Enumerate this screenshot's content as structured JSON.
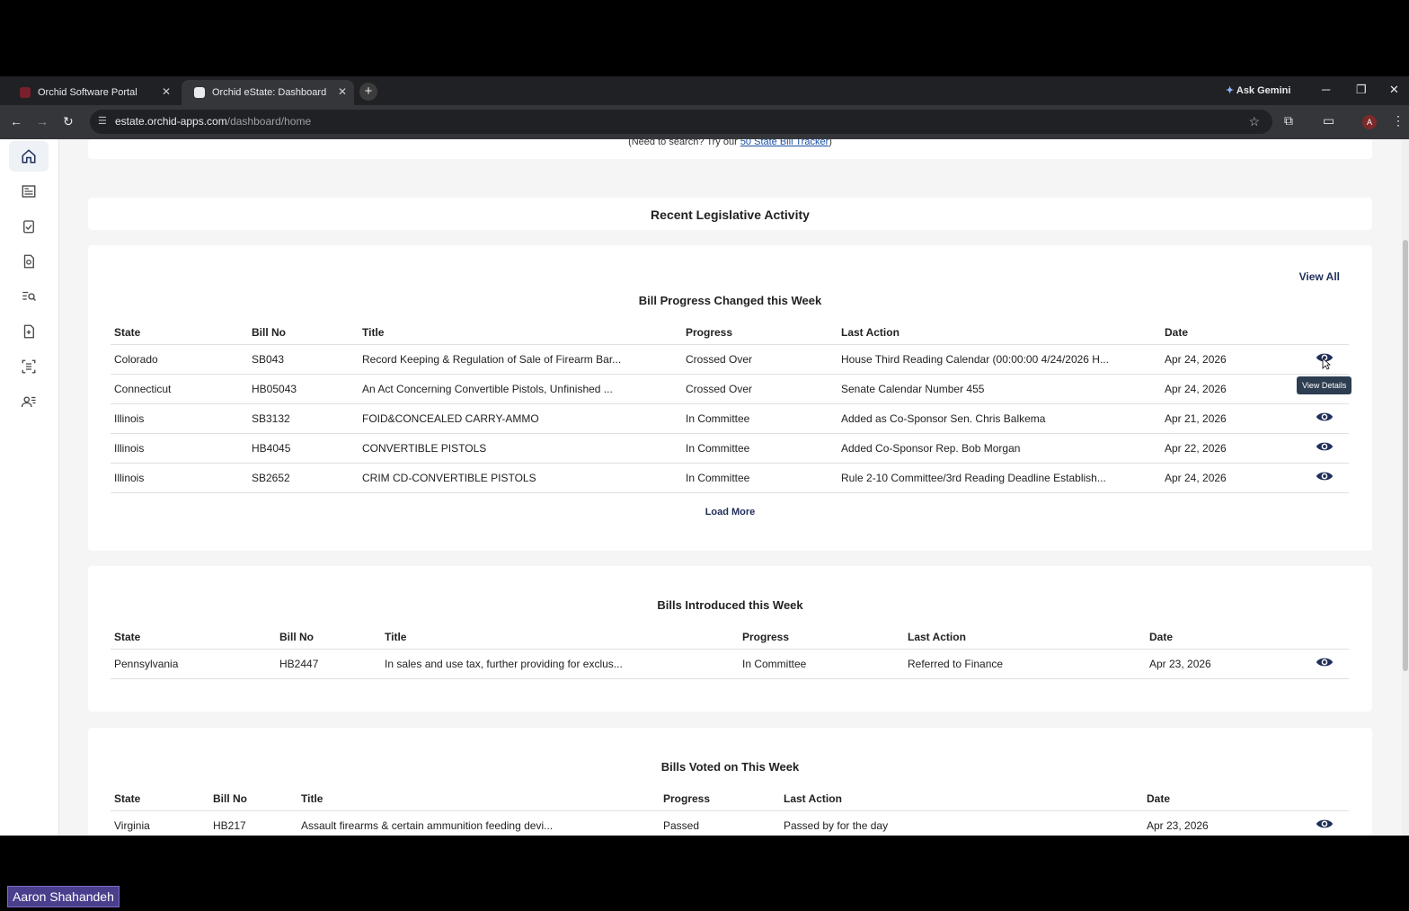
{
  "browser": {
    "tabs": [
      {
        "label": "Orchid Software Portal",
        "active": false
      },
      {
        "label": "Orchid eState: Dashboard",
        "active": true
      }
    ],
    "new_tab": "+",
    "ask_gemini": "Ask Gemini",
    "url_host": "estate.orchid-apps.com",
    "url_path": "/dashboard/home",
    "profile_initial": "A"
  },
  "sidebar": {
    "items": [
      {
        "icon": "home-icon",
        "active": true
      },
      {
        "icon": "newspaper-icon"
      },
      {
        "icon": "clipboard-check-icon"
      },
      {
        "icon": "document-search-icon"
      },
      {
        "icon": "list-search-icon"
      },
      {
        "icon": "file-add-icon"
      },
      {
        "icon": "scan-document-icon"
      },
      {
        "icon": "users-icon"
      }
    ]
  },
  "search_note": {
    "prefix": "(Need to search? Try our ",
    "link": "50 State Bill Tracker",
    "suffix": ")"
  },
  "recent_activity_title": "Recent Legislative Activity",
  "progress_section": {
    "view_all": "View All",
    "title": "Bill Progress Changed this Week",
    "headers": [
      "State",
      "Bill No",
      "Title",
      "Progress",
      "Last Action",
      "Date"
    ],
    "rows": [
      [
        "Colorado",
        "SB043",
        "Record Keeping & Regulation of Sale of Firearm Bar...",
        "Crossed Over",
        "House Third Reading Calendar (00:00:00 4/24/2026 H...",
        "Apr 24, 2026"
      ],
      [
        "Connecticut",
        "HB05043",
        "An Act Concerning Convertible Pistols, Unfinished ...",
        "Crossed Over",
        "Senate Calendar Number 455",
        "Apr 24, 2026"
      ],
      [
        "Illinois",
        "SB3132",
        "FOID&CONCEALED CARRY-AMMO",
        "In Committee",
        "Added as Co-Sponsor Sen. Chris Balkema",
        "Apr 21, 2026"
      ],
      [
        "Illinois",
        "HB4045",
        "CONVERTIBLE PISTOLS",
        "In Committee",
        "Added Co-Sponsor Rep. Bob Morgan",
        "Apr 22, 2026"
      ],
      [
        "Illinois",
        "SB2652",
        "CRIM CD-CONVERTIBLE PISTOLS",
        "In Committee",
        "Rule 2-10 Committee/3rd Reading Deadline Establish...",
        "Apr 24, 2026"
      ]
    ],
    "load_more": "Load More",
    "tooltip": "View Details"
  },
  "introduced_section": {
    "title": "Bills Introduced this Week",
    "headers": [
      "State",
      "Bill No",
      "Title",
      "Progress",
      "Last Action",
      "Date"
    ],
    "rows": [
      [
        "Pennsylvania",
        "HB2447",
        "In sales and use tax, further providing for exclus...",
        "In Committee",
        "Referred to Finance",
        "Apr 23, 2026"
      ]
    ]
  },
  "voted_section": {
    "title": "Bills Voted on This Week",
    "headers": [
      "State",
      "Bill No",
      "Title",
      "Progress",
      "Last Action",
      "Date"
    ],
    "rows": [
      [
        "Virginia",
        "HB217",
        "Assault firearms & certain ammunition feeding devi...",
        "Passed",
        "Passed by for the day",
        "Apr 23, 2026"
      ]
    ]
  },
  "presenter_name": "Aaron Shahandeh",
  "colors": {
    "accent": "#1f2e5a",
    "link": "#1a4fa3"
  }
}
